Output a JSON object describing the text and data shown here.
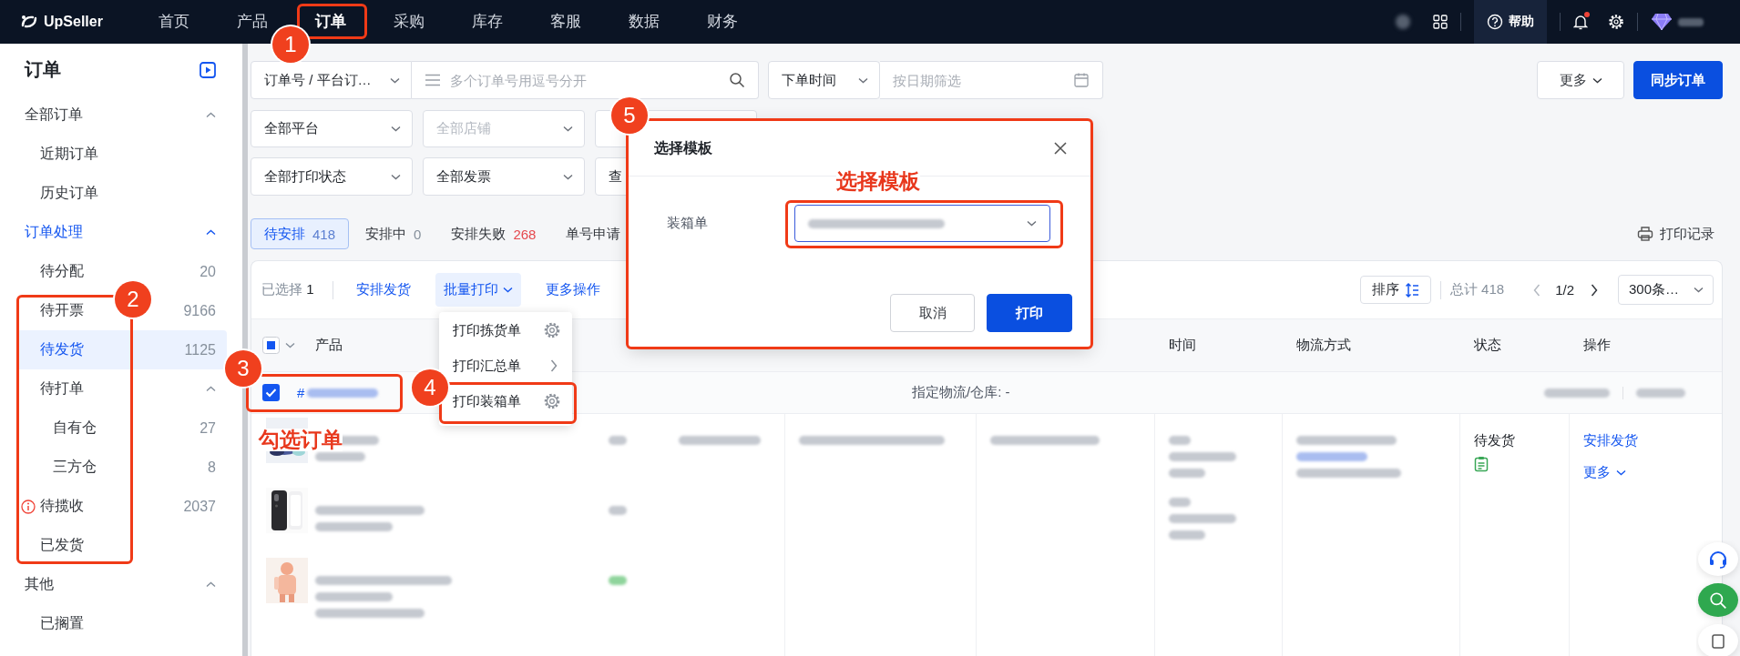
{
  "topbar": {
    "logo": "UpSeller",
    "nav": [
      {
        "label": "首页",
        "selected": false
      },
      {
        "label": "产品",
        "selected": false
      },
      {
        "label": "订单",
        "selected": true
      },
      {
        "label": "采购",
        "selected": false
      },
      {
        "label": "库存",
        "selected": false
      },
      {
        "label": "客服",
        "selected": false
      },
      {
        "label": "数据",
        "selected": false
      },
      {
        "label": "财务",
        "selected": false
      }
    ],
    "help": "帮助",
    "notification": true
  },
  "sidebar": {
    "title": "订单",
    "groups": [
      {
        "label": "全部订单",
        "active": false,
        "expanded": true,
        "children": [
          {
            "label": "近期订单",
            "selected": false
          },
          {
            "label": "历史订单",
            "selected": false
          }
        ]
      },
      {
        "label": "订单处理",
        "active": true,
        "expanded": true,
        "children": [
          {
            "label": "待分配",
            "count": "20",
            "selected": false
          },
          {
            "label": "待开票",
            "count": "9166",
            "selected": false
          },
          {
            "label": "待发货",
            "count": "1125",
            "selected": true
          },
          {
            "label": "待打单",
            "selected": false,
            "expanded": true,
            "children": [
              {
                "label": "自有仓",
                "count": "27",
                "selected": false
              },
              {
                "label": "三方仓",
                "count": "8",
                "selected": false
              }
            ]
          },
          {
            "label": "待揽收",
            "count": "2037",
            "selected": false,
            "alert": true
          },
          {
            "label": "已发货",
            "selected": false
          }
        ]
      },
      {
        "label": "其他",
        "active": false,
        "expanded": true,
        "children": [
          {
            "label": "已搁置",
            "selected": false
          }
        ]
      }
    ]
  },
  "filters": {
    "search_type": "订单号 / 平台订…",
    "search": {
      "placeholder": "多个订单号用逗号分开"
    },
    "date_type": "下单时间",
    "date": {
      "placeholder": "按日期筛选"
    },
    "rows": [
      [
        {
          "value": "全部平台"
        },
        {
          "placeholder": "全部店铺"
        }
      ],
      [
        {
          "value": "全部打印状态"
        },
        {
          "value": "全部发票"
        },
        {
          "value": "查"
        }
      ]
    ],
    "more": "更多",
    "sync": "同步订单"
  },
  "status_tabs": [
    {
      "label": "待安排",
      "count": "418",
      "selected": true,
      "alert": false
    },
    {
      "label": "安排中",
      "count": "0",
      "selected": false,
      "alert": false
    },
    {
      "label": "安排失败",
      "count": "268",
      "selected": false,
      "alert": true
    },
    {
      "label": "单号申请",
      "selected": false
    }
  ],
  "print_log": "打印记录",
  "toolbar": {
    "selected_label": "已选择",
    "selected_count": "1",
    "actions": [
      {
        "label": "安排发货",
        "open": false,
        "caret": false
      },
      {
        "label": "批量打印",
        "open": true,
        "caret": true
      },
      {
        "label": "更多操作",
        "open": false,
        "caret": false
      }
    ],
    "sort": "排序",
    "total": "总计 418",
    "page": "1/2",
    "page_size": "300条…"
  },
  "table": {
    "select_all": {
      "checked": false,
      "indeterminate": true
    },
    "columns": [
      "产品",
      "时间",
      "物流方式",
      "状态",
      "操作"
    ],
    "orders": [
      {
        "checked": true,
        "number_prefix": "#",
        "assignment": "指定物流/仓库: -",
        "status": "待发货",
        "actions": [
          {
            "label": "安排发货",
            "caret": false
          },
          {
            "label": "更多",
            "caret": true
          }
        ],
        "products": [
          {
            "kind": "picture"
          },
          {
            "kind": "picture"
          },
          {
            "kind": "picture"
          }
        ]
      }
    ]
  },
  "batch_print_menu": [
    {
      "label": "打印拣货单",
      "kind": "settings"
    },
    {
      "label": "打印汇总单",
      "kind": "submenu"
    },
    {
      "label": "打印装箱单",
      "kind": "settings"
    }
  ],
  "modal": {
    "title": "选择模板",
    "field_label": "装箱单",
    "buttons": [
      {
        "label": "取消",
        "primary": false
      },
      {
        "label": "打印",
        "primary": true
      }
    ]
  },
  "annotations": {
    "steps": [
      "1",
      "2",
      "3",
      "4",
      "5"
    ],
    "notes": [
      "勾选订单",
      "选择模板"
    ]
  }
}
